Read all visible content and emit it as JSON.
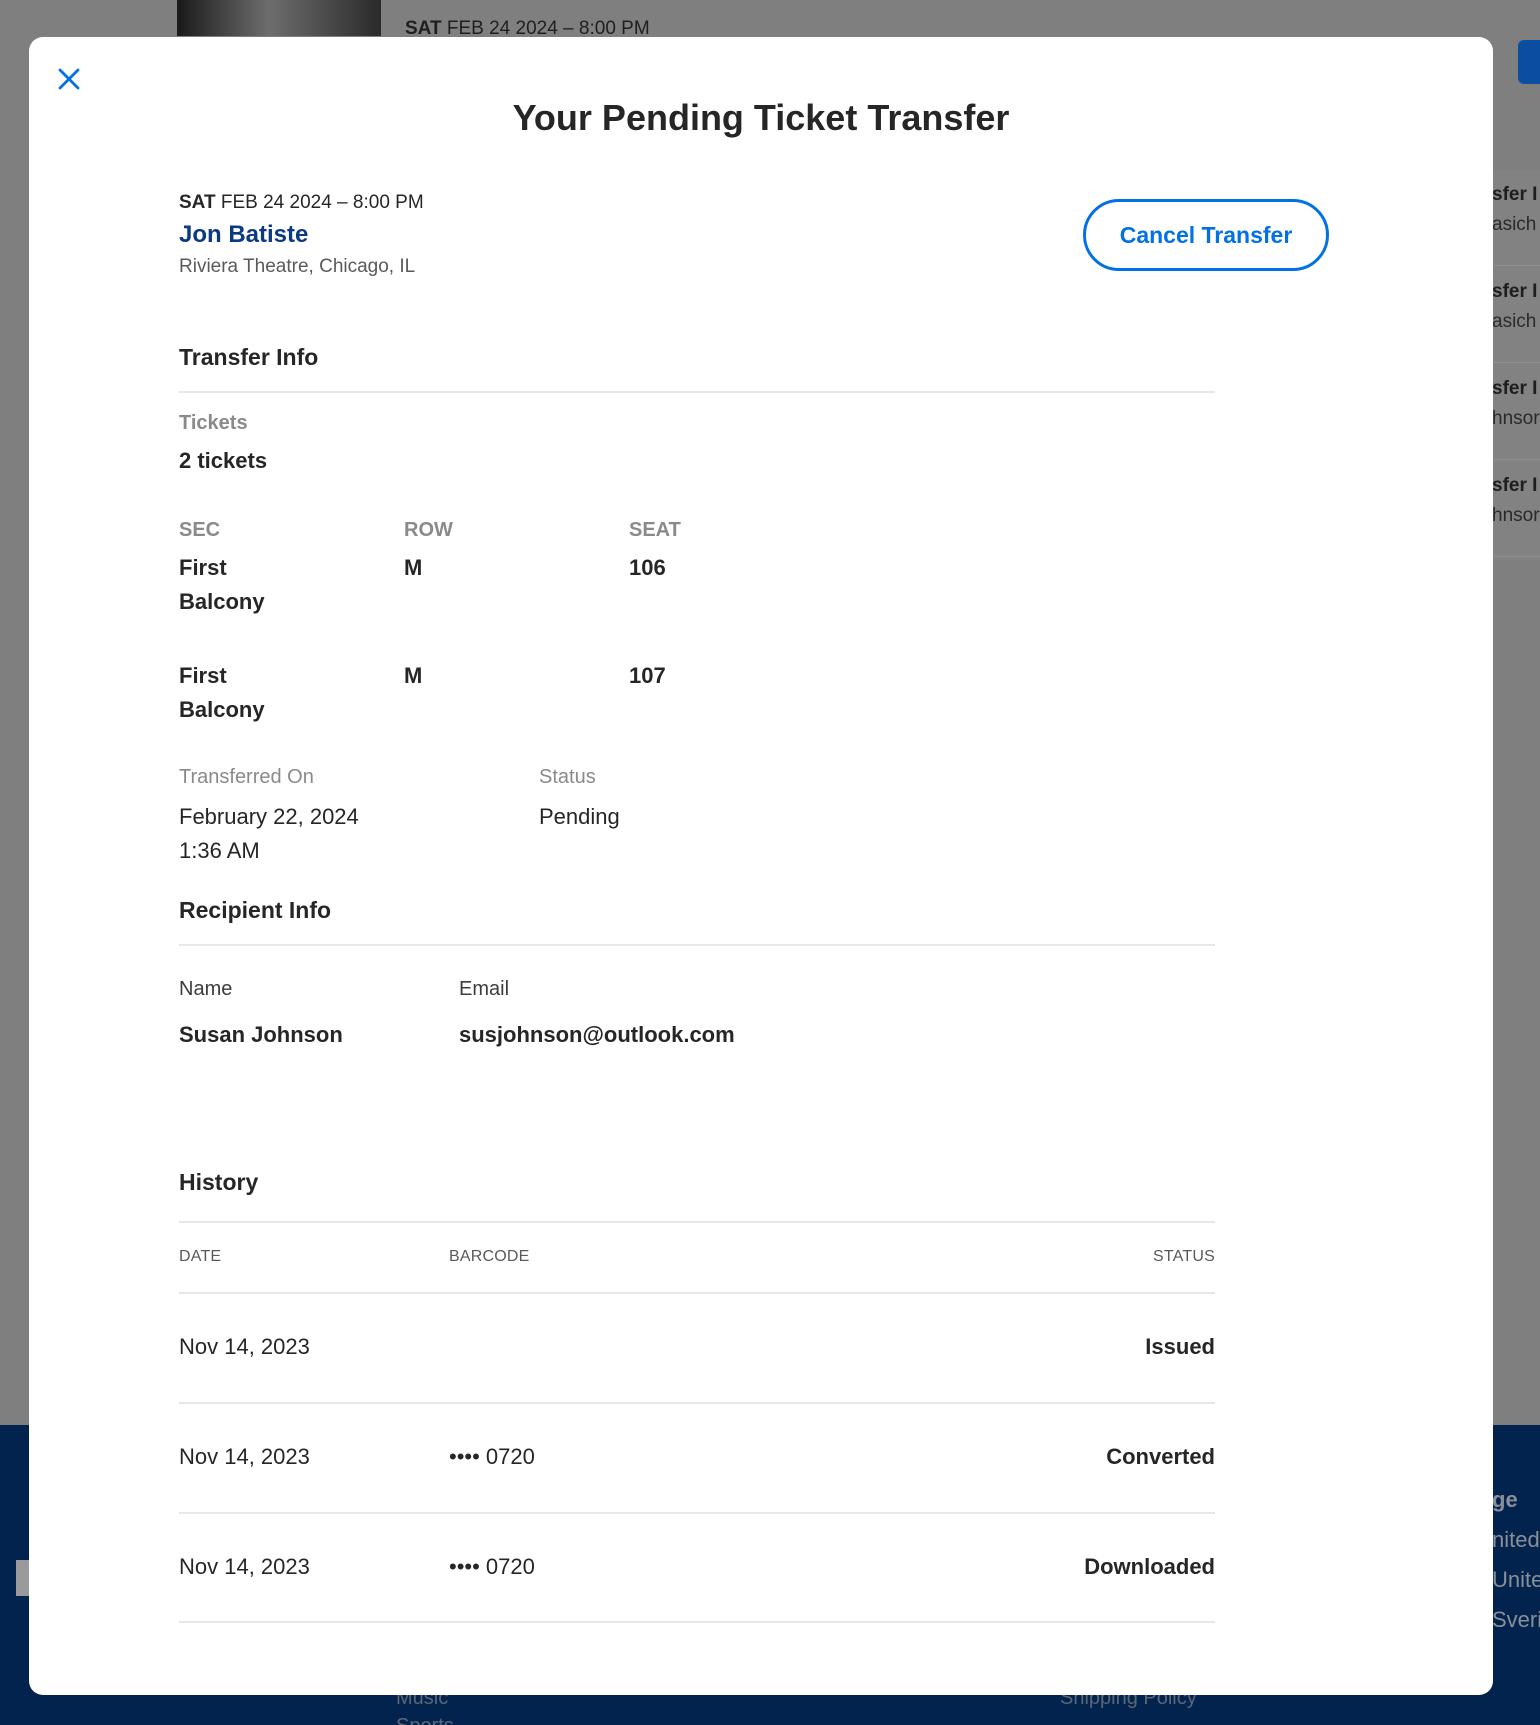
{
  "background": {
    "event_date_dow": "SAT",
    "event_date_rest": " FEB 24 2024 – 8:00 PM",
    "side_items": [
      {
        "line1": "sfer I",
        "line2": "asich"
      },
      {
        "line1": "sfer I",
        "line2": "asich"
      },
      {
        "line1": "sfer I",
        "line2": "hnsor"
      },
      {
        "line1": "sfer I",
        "line2": "hnsor"
      }
    ],
    "footer": {
      "heading": "ge",
      "links_right": [
        "nited",
        "Unite",
        "Sverig"
      ],
      "link_bottom_left": "Music",
      "link_bottom_right": "Shipping Policy",
      "link_bottom_left_2": "Sports"
    }
  },
  "modal": {
    "title": "Your Pending Ticket Transfer",
    "event": {
      "dow": "SAT",
      "date": " FEB 24 2024 – 8:00 PM",
      "name": "Jon Batiste",
      "venue": "Riviera Theatre, Chicago, IL"
    },
    "cancel_label": "Cancel Transfer",
    "transfer_info": {
      "title": "Transfer Info",
      "tickets_label": "Tickets",
      "tickets_value": "2 tickets",
      "columns": {
        "sec": "SEC",
        "row": "ROW",
        "seat": "SEAT"
      },
      "seats": [
        {
          "sec": "First Balcony",
          "row": "M",
          "seat": "106"
        },
        {
          "sec": "First Balcony",
          "row": "M",
          "seat": "107"
        }
      ],
      "transferred_on_label": "Transferred On",
      "transferred_on_date": "February 22, 2024",
      "transferred_on_time": "1:36 AM",
      "status_label": "Status",
      "status_value": "Pending"
    },
    "recipient_info": {
      "title": "Recipient Info",
      "name_label": "Name",
      "name_value": "Susan Johnson",
      "email_label": "Email",
      "email_value": "susjohnson@outlook.com"
    },
    "history": {
      "title": "History",
      "columns": {
        "date": "DATE",
        "barcode": "BARCODE",
        "status": "STATUS"
      },
      "rows": [
        {
          "date": "Nov 14, 2023",
          "barcode": "",
          "status": "Issued"
        },
        {
          "date": "Nov 14, 2023",
          "barcode": "•••• 0720",
          "status": "Converted"
        },
        {
          "date": "Nov 14, 2023",
          "barcode": "•••• 0720",
          "status": "Downloaded"
        }
      ]
    }
  },
  "colors": {
    "accent": "#0271e3",
    "event_name": "#0b3a83",
    "overlay": "#7f7f7f",
    "footer": "#02234e"
  },
  "icons": {
    "close": "close-icon"
  }
}
